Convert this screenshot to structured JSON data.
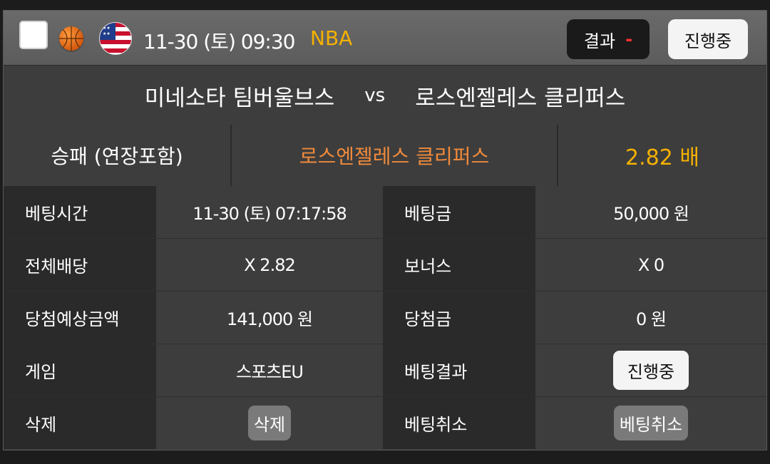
{
  "header": {
    "datetime": "11-30 (토) 09:30",
    "league": "NBA",
    "result_label": "결과",
    "result_value": "-",
    "status_label": "진행중"
  },
  "match": {
    "home": "미네소타 팀버울브스",
    "vs": "vs",
    "away": "로스엔젤레스 클리퍼스"
  },
  "pick": {
    "type": "승패 (연장포함)",
    "team": "로스엔젤레스 클리퍼스",
    "odds": "2.82 배"
  },
  "details": {
    "bet_time_label": "베팅시간",
    "bet_time_value": "11-30 (토) 07:17:58",
    "bet_amount_label": "베팅금",
    "bet_amount_value": "50,000 원",
    "total_odds_label": "전체배당",
    "total_odds_value": "X 2.82",
    "bonus_label": "보너스",
    "bonus_value": "X 0",
    "expected_win_label": "당첨예상금액",
    "expected_win_value": "141,000 원",
    "win_amount_label": "당첨금",
    "win_amount_value": "0 원",
    "game_label": "게임",
    "game_value": "스포츠EU",
    "bet_result_label": "베팅결과",
    "bet_result_value": "진행중",
    "delete_label": "삭제",
    "delete_button": "삭제",
    "cancel_label": "베팅취소",
    "cancel_button": "베팅취소"
  },
  "icons": {
    "sport": "basketball-icon",
    "country": "usa-flag-icon"
  },
  "colors": {
    "league": "#f5b100",
    "pick_team": "#ef8a3c",
    "odds": "#f5b100",
    "result_dash": "#ff3030"
  }
}
